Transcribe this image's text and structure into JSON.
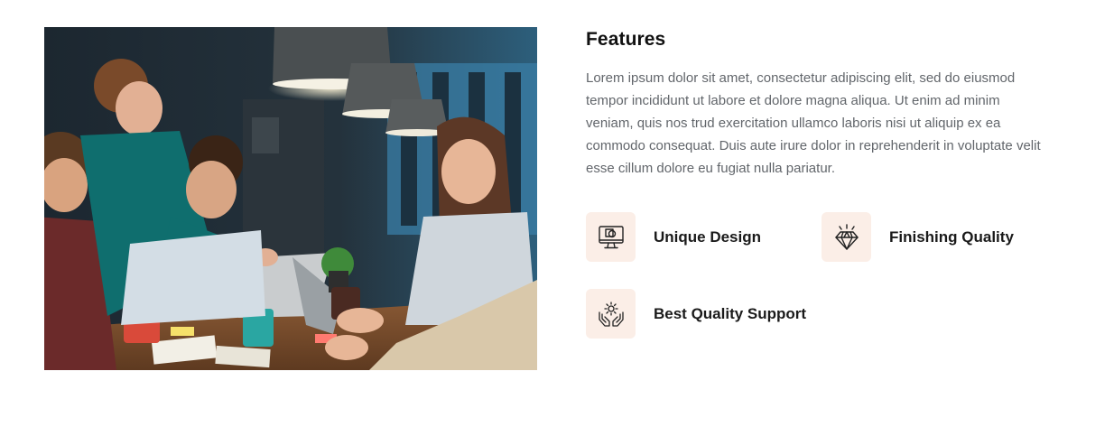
{
  "section": {
    "title": "Features",
    "description": "Lorem ipsum dolor sit amet, consectetur adipiscing elit, sed do eiusmod tempor incididunt ut labore et dolore magna aliqua. Ut enim ad minim veniam, quis nos trud exercitation ullamco laboris nisi ut aliquip ex ea commodo consequat. Duis aute irure dolor in reprehenderit in voluptate velit esse cillum dolore eu fugiat nulla pariatur."
  },
  "features": [
    {
      "label": "Unique Design",
      "icon": "monitor-design-icon"
    },
    {
      "label": "Finishing Quality",
      "icon": "diamond-icon"
    },
    {
      "label": "Best Quality Support",
      "icon": "hands-gear-icon"
    }
  ],
  "colors": {
    "icon_bg": "#fbeee7",
    "title": "#111111",
    "body_text": "#62666b"
  }
}
